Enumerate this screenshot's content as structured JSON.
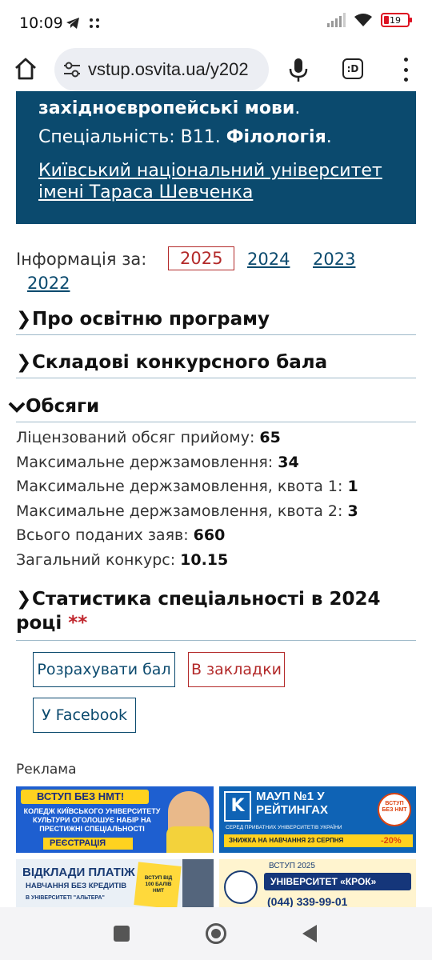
{
  "status_bar": {
    "time": "10:09",
    "battery": "19"
  },
  "browser": {
    "url": "vstup.osvita.ua/y202"
  },
  "banner": {
    "line1": "західноєвропейські мови",
    "line1_suffix": ".",
    "specialty_label": "Спеціальність: В11. ",
    "specialty_name": "Філологія",
    "specialty_suffix": ".",
    "university": "Київський національний університет імені Тараса Шевченка"
  },
  "info": {
    "label": "Інформація за:",
    "years": [
      "2025",
      "2024",
      "2023",
      "2022"
    ]
  },
  "sections": {
    "about": "Про освітню програму",
    "score": "Складові конкурсного бала",
    "volumes": "Обсяги",
    "stats": "Статистика спеціальності в 2024 році",
    "stats_mark": "**"
  },
  "facts": [
    {
      "label": "Ліцензований обсяг прийому: ",
      "value": "65"
    },
    {
      "label": "Максимальне держзамовлення: ",
      "value": "34"
    },
    {
      "label": "Максимальне держзамовлення, квота 1: ",
      "value": "1"
    },
    {
      "label": "Максимальне держзамовлення, квота 2: ",
      "value": "3"
    },
    {
      "label": "Всього поданих заяв: ",
      "value": "660"
    },
    {
      "label": "Загальний конкурс: ",
      "value": "10.15"
    }
  ],
  "buttons": {
    "calculate": "Розрахувати бал",
    "bookmark": "В закладки",
    "facebook": "У Facebook"
  },
  "ads": {
    "label": "Реклама",
    "ad1": {
      "title": "ВСТУП БЕЗ НМТ!",
      "body": "КОЛЕДЖ КИЇВСЬКОГО УНІВЕРСИТЕТУ КУЛЬТУРИ ОГОЛОШУЄ НАБІР НА ПРЕСТИЖНІ СПЕЦІАЛЬНОСТІ",
      "cta": "РЕЄСТРАЦІЯ"
    },
    "ad2": {
      "title": "МАУП №1 У РЕЙТИНГАХ",
      "sub": "СЕРЕД ПРИВАТНИХ УНІВЕРСИТЕТІВ УКРАЇНИ",
      "discount": "ЗНИЖКА НА НАВЧАННЯ 23 СЕРПНЯ",
      "percent": "-20%",
      "badge": "ВСТУП БЕЗ НМТ"
    },
    "ad3": {
      "title": "ВІДКЛАДИ ПЛАТІЖ",
      "sub": "НАВЧАННЯ БЕЗ КРЕДИТІВ",
      "small": "В УНІВЕРСИТЕТІ \"АЛЬТЕРА\"",
      "note": "ВСТУП ВІД 100 БАЛІВ НМТ"
    },
    "ad4": {
      "top": "ВСТУП 2025",
      "title": "УНІВЕРСИТЕТ «КРОК»",
      "phone": "(044) 339-99-01"
    }
  }
}
